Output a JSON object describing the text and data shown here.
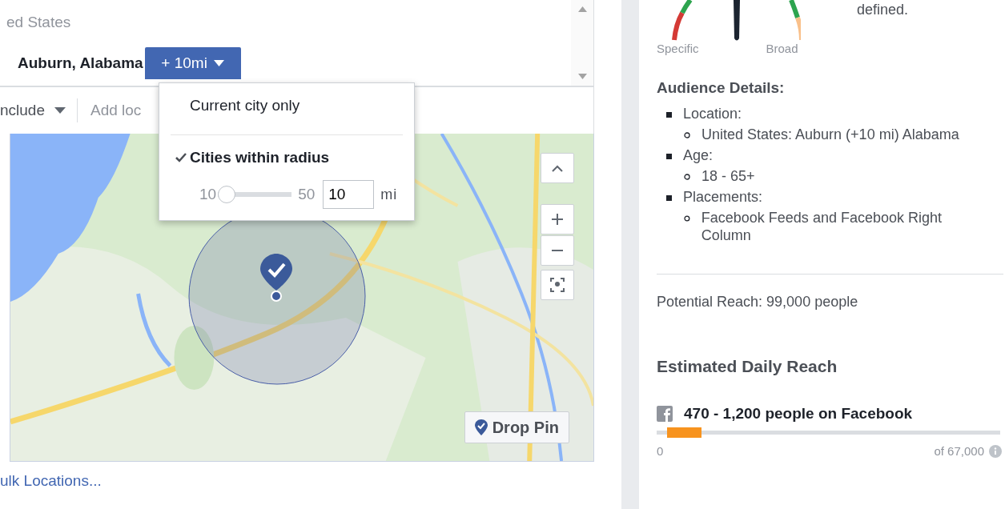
{
  "location_panel": {
    "country": "ed States",
    "selected_location": "Auburn, Alabama",
    "radius_button": "+ 10mi",
    "include_dropdown": "nclude",
    "add_location": {
      "placeholder": "Add loc"
    },
    "bulk_link": "ulk Locations..."
  },
  "radius_menu": {
    "options": [
      {
        "label": "Current city only",
        "selected": false
      },
      {
        "label": "Cities within radius",
        "selected": true
      }
    ],
    "slider": {
      "min_label": "10",
      "max_label": "50",
      "level": 0
    },
    "value": "10",
    "unit": "mi"
  },
  "map": {
    "kind": "picture",
    "drop_pin": "Drop Pin"
  },
  "audience_meter": {
    "text": "defined.",
    "left_label": "Specific",
    "right_label": "Broad"
  },
  "audience_details": {
    "title": "Audience Details:",
    "items": [
      {
        "label": "Location:",
        "children": [
          {
            "label": "United States: Auburn (+10 mi) Alabama"
          }
        ]
      },
      {
        "label": "Age:",
        "children": [
          {
            "label": "18 - 65+"
          }
        ]
      },
      {
        "label": "Placements:",
        "children": [
          {
            "label": "Facebook Feeds and Facebook Right Column"
          }
        ]
      }
    ]
  },
  "potential_reach": "Potential Reach: 99,000 people",
  "daily_reach": {
    "title": "Estimated Daily Reach",
    "text": "470 - 1,200 people on Facebook",
    "level": 0.1,
    "min_label": "0",
    "max_label": "of 67,000"
  }
}
